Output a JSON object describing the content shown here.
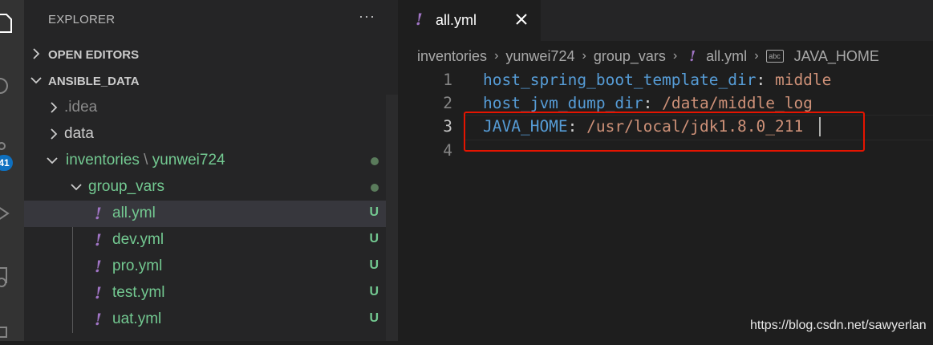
{
  "sidebar": {
    "title": "EXPLORER",
    "more": "···",
    "sections": {
      "open_editors": "OPEN EDITORS",
      "ansible_data": "ANSIBLE_DATA"
    },
    "tree": {
      "idea": ".idea",
      "data": "data",
      "inventories": "inventories",
      "inventories_sep": "\\",
      "yunwei": "yunwei724",
      "group_vars": "group_vars",
      "files": [
        {
          "name": "all.yml",
          "status": "U",
          "icon": "!"
        },
        {
          "name": "dev.yml",
          "status": "U",
          "icon": "!"
        },
        {
          "name": "pro.yml",
          "status": "U",
          "icon": "!"
        },
        {
          "name": "test.yml",
          "status": "U",
          "icon": "!"
        },
        {
          "name": "uat.yml",
          "status": "U",
          "icon": "!"
        }
      ]
    }
  },
  "activity": {
    "badge": "41"
  },
  "editor": {
    "tab": {
      "icon": "!",
      "name": "all.yml"
    },
    "breadcrumb": {
      "seg1": "inventories",
      "seg2": "yunwei724",
      "seg3": "group_vars",
      "seg4_icon": "!",
      "seg4": "all.yml",
      "seg5_icon": "abc",
      "seg5": "JAVA_HOME",
      "sep": "›"
    },
    "lines": [
      {
        "num": "1",
        "key": "host_spring_boot_template_dir",
        "colon": ":",
        "value": " middle"
      },
      {
        "num": "2",
        "key": "host_jvm_dump_dir",
        "colon": ":",
        "value": " /data/middle_log"
      },
      {
        "num": "3",
        "key": "JAVA_HOME",
        "colon": ":",
        "value": " /usr/local/jdk1.8.0_211"
      },
      {
        "num": "4",
        "key": "",
        "colon": "",
        "value": ""
      }
    ]
  },
  "watermark": "https://blog.csdn.net/sawyerlan",
  "colors": {
    "accent": "#0e70c0",
    "highlight": "#e51400",
    "untracked": "#73c991",
    "yaml_icon": "#a074c4"
  }
}
